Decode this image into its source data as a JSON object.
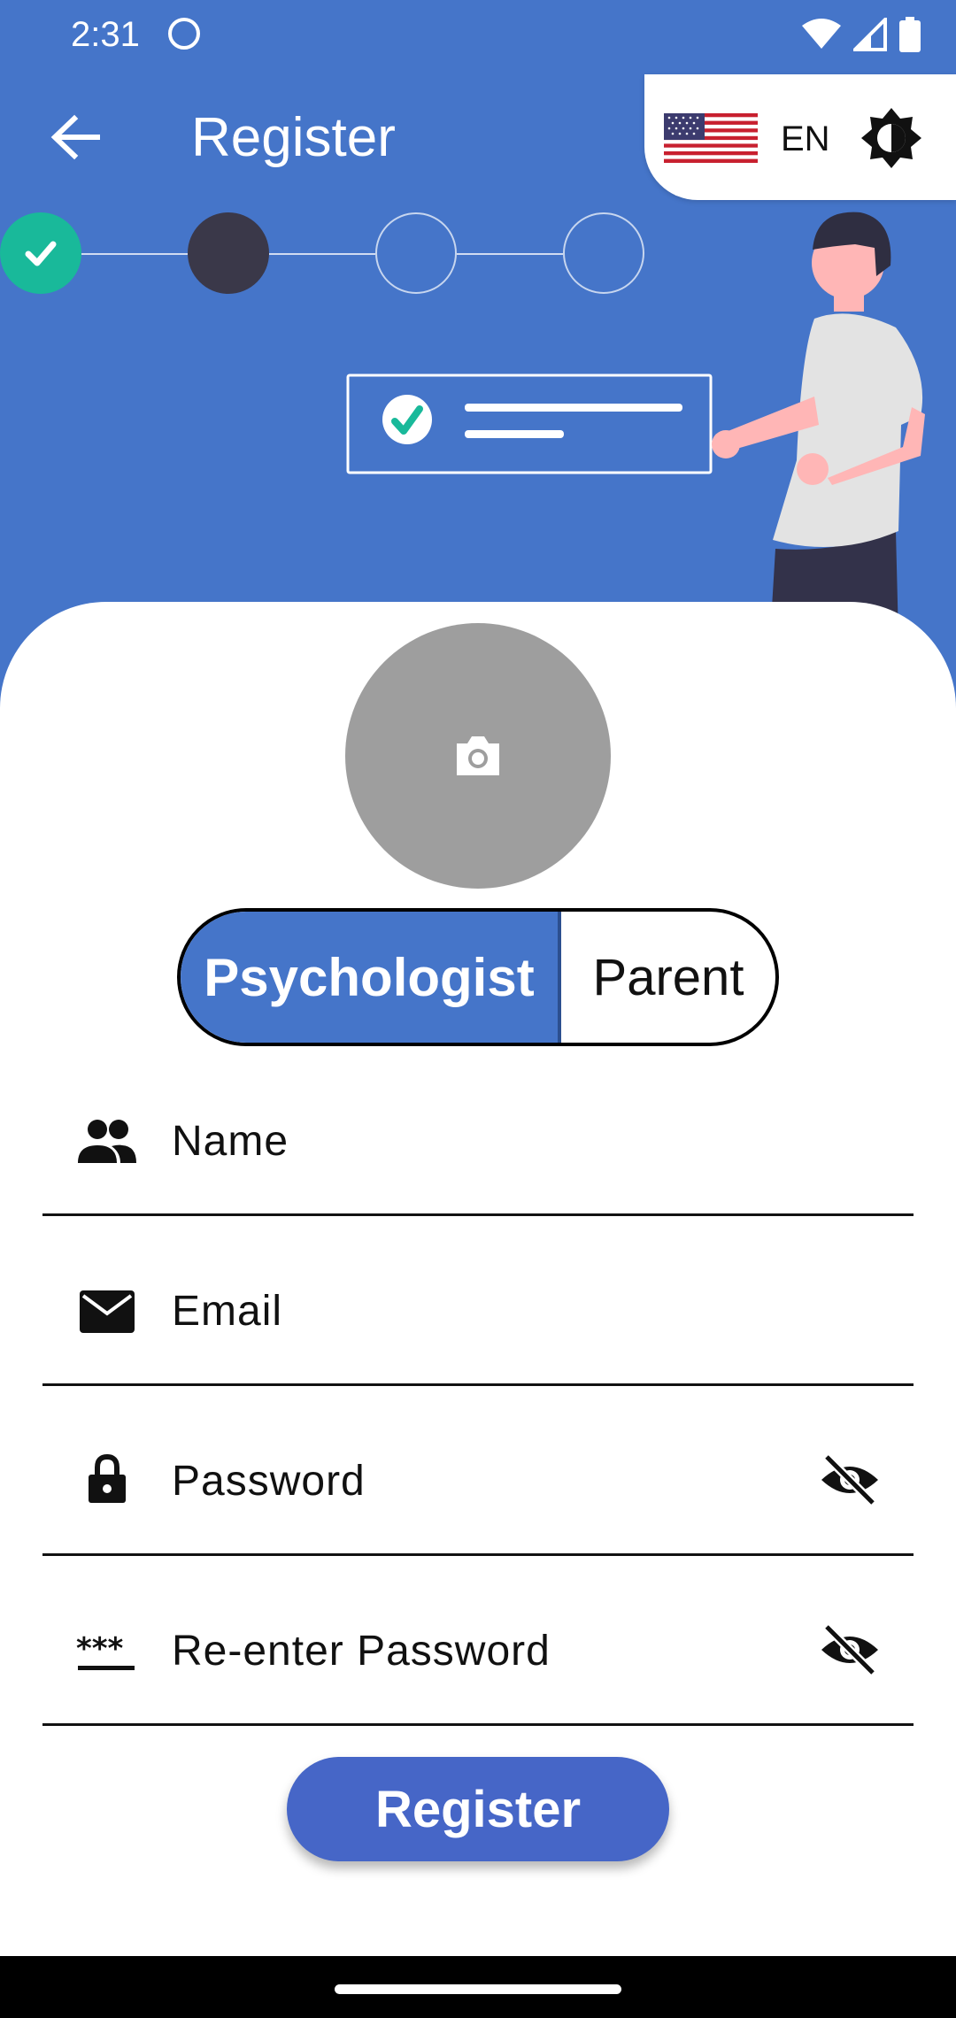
{
  "status_bar": {
    "time": "2:31"
  },
  "app_bar": {
    "title": "Register"
  },
  "language": {
    "code": "EN"
  },
  "roles": {
    "selected": "Psychologist",
    "options": [
      "Psychologist",
      "Parent"
    ]
  },
  "form": {
    "name_label": "Name",
    "email_label": "Email",
    "password_label": "Password",
    "repassword_label": "Re-enter Password"
  },
  "register_button": "Register",
  "stepper": {
    "total": 4,
    "completed": 1,
    "current": 2
  },
  "colors": {
    "primary": "#4575c9",
    "button": "#4666c7",
    "step_done": "#19b99a",
    "step_current": "#3a3849",
    "avatar": "#9e9e9e"
  }
}
